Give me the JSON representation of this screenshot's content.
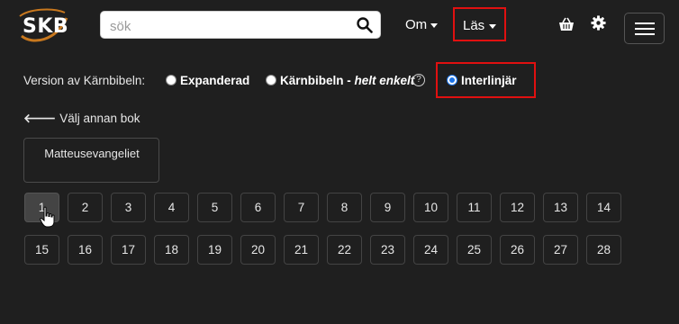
{
  "header": {
    "logo_text": "SKB",
    "search": {
      "placeholder": "sök",
      "value": ""
    },
    "nav": {
      "om_label": "Om",
      "las_label": "Läs"
    },
    "icons": [
      "basket-icon",
      "gear-icon",
      "hamburger-menu-icon",
      "search-icon"
    ]
  },
  "version": {
    "label": "Version av Kärnbibeln:",
    "options": [
      {
        "label": "Expanderad",
        "selected": false
      },
      {
        "label": "Kärnbibeln - ",
        "label_em": "helt enkelt",
        "selected": false
      },
      {
        "label": "Interlinjär",
        "selected": true
      }
    ],
    "help_glyph": "?"
  },
  "back_link": {
    "arrow": "🡐",
    "label": "Välj annan bok"
  },
  "book": {
    "name": "Matteusevangeliet"
  },
  "chapters": {
    "numbers": [
      "1",
      "2",
      "3",
      "4",
      "5",
      "6",
      "7",
      "8",
      "9",
      "10",
      "11",
      "12",
      "13",
      "14",
      "15",
      "16",
      "17",
      "18",
      "19",
      "20",
      "21",
      "22",
      "23",
      "24",
      "25",
      "26",
      "27",
      "28"
    ],
    "active": "1"
  },
  "colors": {
    "background": "#1f1f1f",
    "highlight_box": "#e01010",
    "radio_checked": "#1a73e8"
  }
}
